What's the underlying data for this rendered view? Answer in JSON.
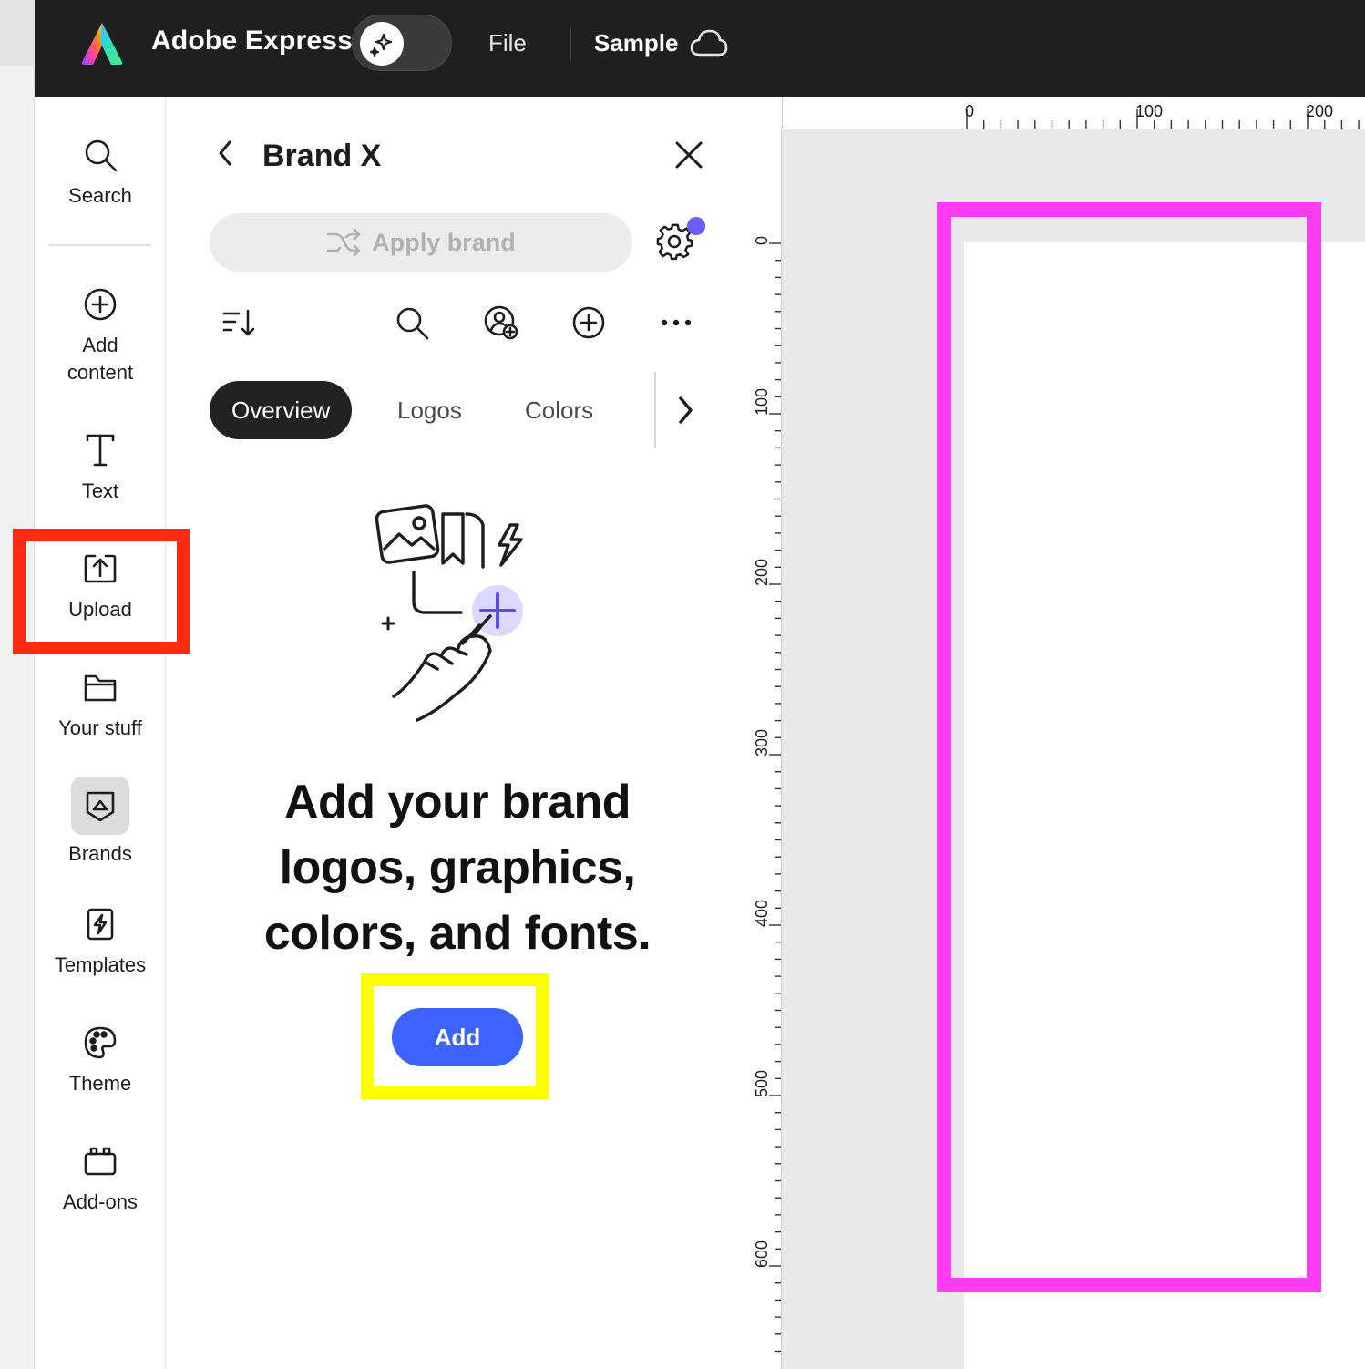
{
  "header": {
    "app_title": "Adobe Express",
    "file_menu": "File",
    "document_title": "Sample"
  },
  "rail": {
    "items": [
      {
        "label": "Search",
        "icon": "search-icon"
      },
      {
        "label": "Add\ncontent",
        "icon": "plus-circle-icon"
      },
      {
        "label": "Text",
        "icon": "text-icon"
      },
      {
        "label": "Upload",
        "icon": "upload-icon"
      },
      {
        "label": "Your stuff",
        "icon": "folder-icon"
      },
      {
        "label": "Brands",
        "icon": "brand-icon"
      },
      {
        "label": "Templates",
        "icon": "templates-icon"
      },
      {
        "label": "Theme",
        "icon": "palette-icon"
      },
      {
        "label": "Add-ons",
        "icon": "addons-icon"
      }
    ]
  },
  "panel": {
    "title": "Brand X",
    "apply_brand": "Apply brand",
    "tabs": [
      "Overview",
      "Logos",
      "Colors"
    ],
    "active_tab": "Overview",
    "headline": "Add your brand logos, graphics, colors, and fonts.",
    "add_button": "Add"
  },
  "ruler": {
    "top_labels": [
      "0",
      "100",
      "200"
    ],
    "left_labels": [
      "0",
      "100",
      "200",
      "300",
      "400",
      "500",
      "600"
    ]
  },
  "colors": {
    "accent": "#3d63ff",
    "highlight_red": "#ff2a12",
    "highlight_yellow": "#fcff00",
    "highlight_magenta": "#ff3cf3",
    "notification_dot": "#6b5cf6"
  }
}
